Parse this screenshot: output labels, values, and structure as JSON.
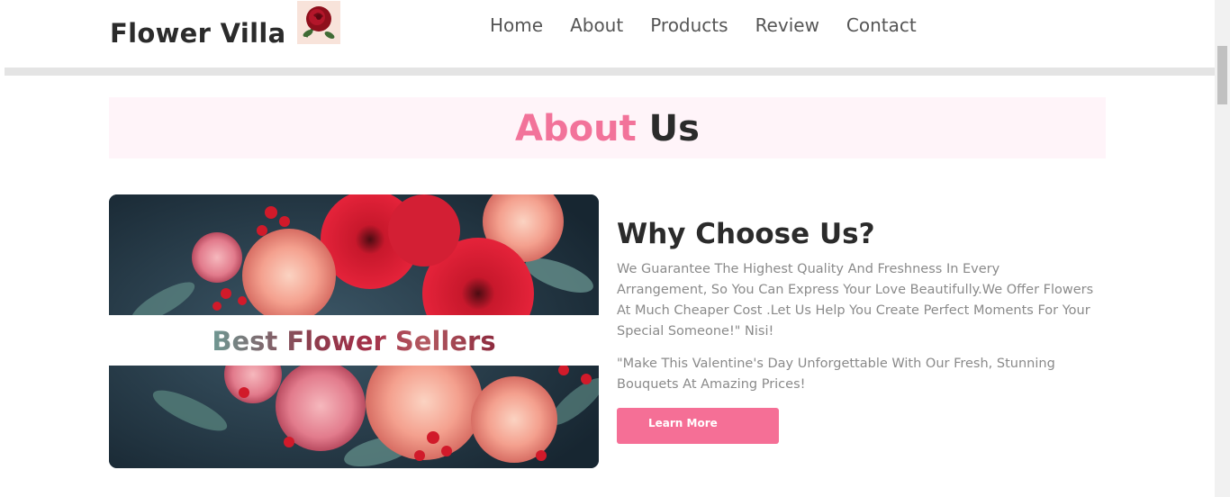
{
  "header": {
    "logo_text": "Flower Villa",
    "logo_icon": "rose-image",
    "nav": [
      {
        "label": "Home"
      },
      {
        "label": "About"
      },
      {
        "label": "Products"
      },
      {
        "label": "Review"
      },
      {
        "label": "Contact"
      }
    ]
  },
  "about": {
    "title_highlight": "About",
    "title_rest": "Us",
    "image_banner": "Best Flower Sellers",
    "heading": "Why Choose Us?",
    "paragraph1": "We Guarantee The Highest Quality And Freshness In Every Arrangement, So You Can Express Your Love Beautifully.We Offer Flowers At Much Cheaper Cost .Let Us Help You Create Perfect Moments For Your Special Someone!\" Nisi!",
    "paragraph2": "\"Make This Valentine's Day Unforgettable With Our Fresh, Stunning Bouquets At Amazing Prices!",
    "button_label": "Learn More"
  },
  "colors": {
    "accent_pink": "#f56f96",
    "heading_dark": "#2b2b2b",
    "muted_text": "#8a8a8a",
    "about_bg": "#fff4f9"
  }
}
